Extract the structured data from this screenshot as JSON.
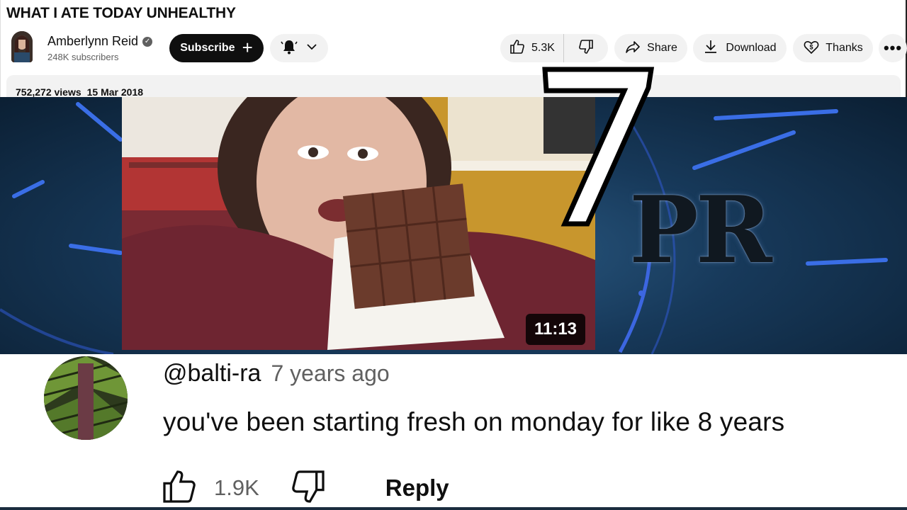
{
  "video": {
    "title": "WHAT I ATE TODAY UNHEALTHY",
    "views": "752,272 views",
    "date": "15 Mar 2018",
    "duration": "11:13"
  },
  "channel": {
    "name": "Amberlynn Reid",
    "subscribers": "248K subscribers",
    "subscribe_label": "Subscribe"
  },
  "actions": {
    "like_count": "5.3K",
    "share_label": "Share",
    "download_label": "Download",
    "thanks_label": "Thanks",
    "more_label": "•••"
  },
  "overlay": {
    "number": "7",
    "logo_text": "PR"
  },
  "comment": {
    "author": "@balti-ra",
    "time": "7 years ago",
    "text": "you've been starting fresh on monday for like 8 years",
    "like_count": "1.9K",
    "reply_label": "Reply"
  },
  "icons": {
    "verified": "verified-check-icon",
    "bell": "bell-icon",
    "chevron": "chevron-down-icon",
    "like": "thumbs-up-icon",
    "dislike": "thumbs-down-icon",
    "share": "share-arrow-icon",
    "download": "download-icon",
    "thanks": "thanks-heart-dollar-icon"
  },
  "colors": {
    "subscribe_bg": "#0f0f0f",
    "pill_bg": "#f2f2f2",
    "secondary_text": "#606060",
    "video_bg": "#17395a"
  }
}
